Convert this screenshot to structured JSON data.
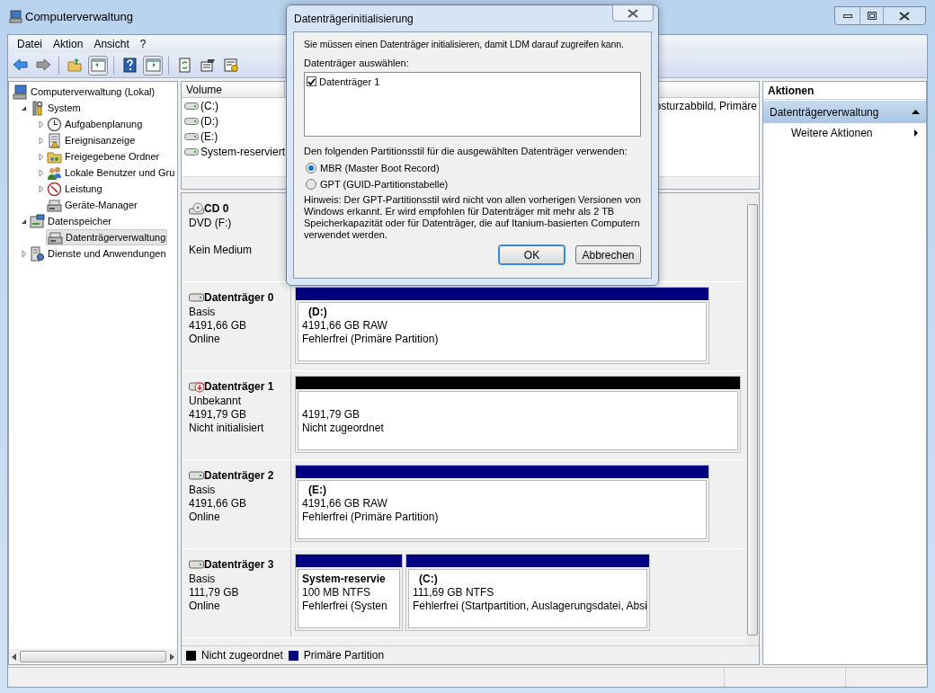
{
  "window": {
    "title": "Computerverwaltung"
  },
  "menu": [
    "Datei",
    "Aktion",
    "Ansicht",
    "?"
  ],
  "tree": [
    {
      "label": "Computerverwaltung (Lokal)",
      "kind": "computer",
      "selected": false,
      "children": [
        {
          "label": "System",
          "kind": "tools",
          "selected": false,
          "expanded": true,
          "children": [
            {
              "label": "Aufgabenplanung",
              "kind": "clock",
              "selected": false,
              "expanded": false
            },
            {
              "label": "Ereignisanzeige",
              "kind": "log",
              "selected": false,
              "expanded": false
            },
            {
              "label": "Freigegebene Ordner",
              "kind": "folder",
              "selected": false,
              "expanded": false
            },
            {
              "label": "Lokale Benutzer und Gru",
              "kind": "users",
              "selected": false,
              "expanded": false
            },
            {
              "label": "Leistung",
              "kind": "gauge",
              "selected": false,
              "expanded": false
            },
            {
              "label": "Geräte-Manager",
              "kind": "device",
              "selected": false
            }
          ]
        },
        {
          "label": "Datenspeicher",
          "kind": "storage",
          "selected": false,
          "expanded": true,
          "children": [
            {
              "label": "Datenträgerverwaltung",
              "kind": "device",
              "selected": true
            }
          ]
        },
        {
          "label": "Dienste und Anwendungen",
          "kind": "services",
          "selected": false,
          "expanded": false
        }
      ]
    }
  ],
  "volume_list": {
    "columns": [
      "Volume"
    ],
    "rows": [
      {
        "volume": "(C:)",
        "column_2": "osturzabbild, Primäre"
      },
      {
        "volume": "(D:)"
      },
      {
        "volume": "(E:)"
      },
      {
        "volume": "System-reserviert"
      }
    ]
  },
  "disks": [
    {
      "title": "CD 0",
      "kind": "cd",
      "type": "DVD (F:)",
      "status": "Kein Medium"
    },
    {
      "title": "Datenträger 0",
      "kind": "disk",
      "type": "Basis",
      "size": "4191,66 GB",
      "status": "Online",
      "partitions": [
        {
          "kind": "primary",
          "label": "(D:)",
          "size": "4191,66 GB RAW",
          "status": "Fehlerfrei (Primäre Partition)"
        }
      ]
    },
    {
      "title": "Datenträger 1",
      "kind": "disk_error",
      "type": "Unbekannt",
      "size": "4191,79 GB",
      "status": "Nicht initialisiert",
      "partitions": [
        {
          "kind": "unallocated",
          "size": "4191,79 GB",
          "status": "Nicht zugeordnet"
        }
      ]
    },
    {
      "title": "Datenträger 2",
      "kind": "disk",
      "type": "Basis",
      "size": "4191,66 GB",
      "status": "Online",
      "partitions": [
        {
          "kind": "primary",
          "label": "(E:)",
          "size": "4191,66 GB RAW",
          "status": "Fehlerfrei (Primäre Partition)"
        }
      ]
    },
    {
      "title": "Datenträger 3",
      "kind": "disk",
      "type": "Basis",
      "size": "111,79 GB",
      "status": "Online",
      "partitions": [
        {
          "kind": "primary",
          "name": "System-reservie",
          "size": "100 MB NTFS",
          "status": "Fehlerfrei (Systen"
        },
        {
          "kind": "primary",
          "label": "(C:)",
          "size": "111,69 GB NTFS",
          "status": "Fehlerfrei (Startpartition, Auslagerungsdatei, Absi"
        }
      ]
    }
  ],
  "legend": [
    {
      "label": "Nicht zugeordnet",
      "color": "#000000"
    },
    {
      "label": "Primäre Partition",
      "color": "#000080"
    }
  ],
  "actions": {
    "title": "Aktionen",
    "section": {
      "label": "Datenträgerverwaltung",
      "expanded": true
    },
    "items": [
      "Weitere Aktionen"
    ]
  },
  "dialog": {
    "title": "Datenträgerinitialisierung",
    "intro": "Sie müssen einen Datenträger initialisieren, damit LDM darauf zugreifen kann.",
    "list_label": "Datenträger auswählen:",
    "disks": [
      {
        "label": "Datenträger 1",
        "checked": true
      }
    ],
    "style_label": "Den folgenden Partitionsstil für die ausgewählten Datenträger verwenden:",
    "styles": [
      {
        "label": "MBR (Master Boot Record)",
        "selected": true
      },
      {
        "label": "GPT (GUID-Partitionstabelle)",
        "selected": false
      }
    ],
    "note": "Hinweis: Der GPT-Partitionsstil wird nicht von allen vorherigen Versionen von Windows erkannt. Er wird empfohlen für Datenträger mit mehr als 2 TB Speicherkapazität oder für Datenträger, die auf Itanium-basierten Computern verwendet werden.",
    "buttons": [
      "OK",
      "Abbrechen"
    ]
  }
}
